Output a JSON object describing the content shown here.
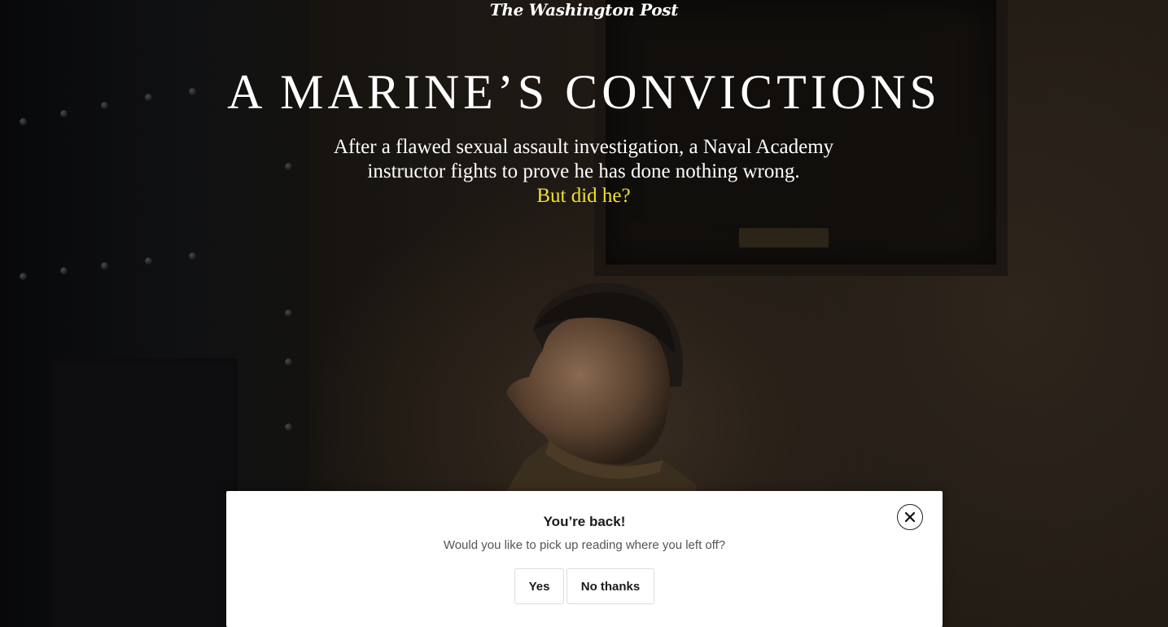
{
  "header": {
    "logo_text": "The Washington Post"
  },
  "article": {
    "headline": "A MARINE’S CONVICTIONS",
    "dek": "After a flawed sexual assault investigation, a Naval Academy instructor fights to prove he has done nothing wrong.",
    "dek_question": "But did he?",
    "accent_color": "#f2e02c"
  },
  "resume_modal": {
    "title": "You’re back!",
    "message": "Would you like to pick up reading where you left off?",
    "yes_label": "Yes",
    "no_label": "No thanks",
    "close_icon": "close-icon"
  }
}
